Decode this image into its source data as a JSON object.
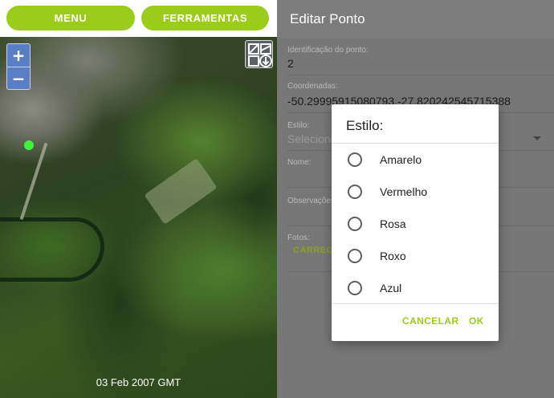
{
  "map_panel": {
    "menu_label": "MENU",
    "tools_label": "FERRAMENTAS",
    "zoom_in": "+",
    "zoom_out": "−",
    "imagery_date": "03 Feb 2007 GMT"
  },
  "form": {
    "title": "Editar Ponto",
    "id_label": "Identificação do ponto:",
    "id_value": "2",
    "coords_label": "Coordenadas:",
    "coords_value": "-50.29995915080793,-27.820242545715388",
    "style_label": "Estilo:",
    "style_placeholder": "Selecione",
    "name_label": "Nome:",
    "notes_label": "Observações:",
    "photos_label": "Fotos:",
    "upload_label": "CARREGAR"
  },
  "dialog": {
    "title": "Estilo:",
    "options": [
      {
        "label": "Amarelo"
      },
      {
        "label": "Vermelho"
      },
      {
        "label": "Rosa"
      },
      {
        "label": "Roxo"
      },
      {
        "label": "Azul"
      }
    ],
    "cancel_label": "CANCELAR",
    "ok_label": "OK"
  },
  "colors": {
    "accent": "#9ccc1a",
    "zoom_control": "#5a7ec6",
    "gps_marker": "#3ef23e"
  }
}
